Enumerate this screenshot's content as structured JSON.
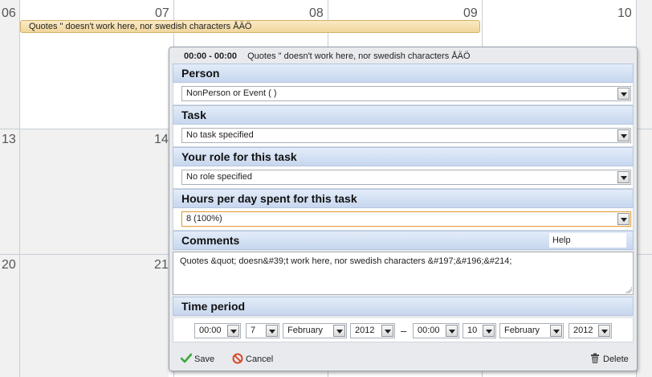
{
  "calendar": {
    "days_row1": [
      "06",
      "07",
      "08",
      "09",
      "10"
    ],
    "days_row2": [
      "13",
      "14"
    ],
    "days_row3": [
      "20",
      "21"
    ],
    "event_bar_text": "Quotes \" doesn't work here, nor swedish characters ÅÄÖ"
  },
  "popup": {
    "time_range": "00:00 - 00:00",
    "title": "Quotes \" doesn't work here, nor swedish characters ÅÄÖ",
    "person": {
      "label": "Person",
      "value": "NonPerson or Event ( )"
    },
    "task": {
      "label": "Task",
      "value": "No task specified"
    },
    "role": {
      "label": "Your role for this task",
      "value": "No role specified"
    },
    "hours": {
      "label": "Hours per day spent for this task",
      "value": "8 (100%)"
    },
    "comments": {
      "label": "Comments",
      "help": "Help",
      "text": "Quotes &quot; doesn&#39;t work here, nor swedish characters &#197;&#196;&#214;"
    },
    "time_period": {
      "label": "Time period",
      "start": {
        "time": "00:00",
        "day": "7",
        "month": "February",
        "year": "2012"
      },
      "separator": "–",
      "end": {
        "time": "00:00",
        "day": "10",
        "month": "February",
        "year": "2012"
      }
    },
    "footer": {
      "save": "Save",
      "cancel": "Cancel",
      "delete": "Delete"
    }
  },
  "colors": {
    "section_header_top": "#e3ecf9",
    "section_header_bottom": "#c7d7ee",
    "event_bar": "#f0d69c",
    "save_icon": "#3aa83a",
    "cancel_icon": "#d84a2a"
  },
  "icons": {
    "save": "check-icon",
    "cancel": "cancel-icon",
    "delete": "trash-icon",
    "dropdown": "chevron-down-icon"
  }
}
